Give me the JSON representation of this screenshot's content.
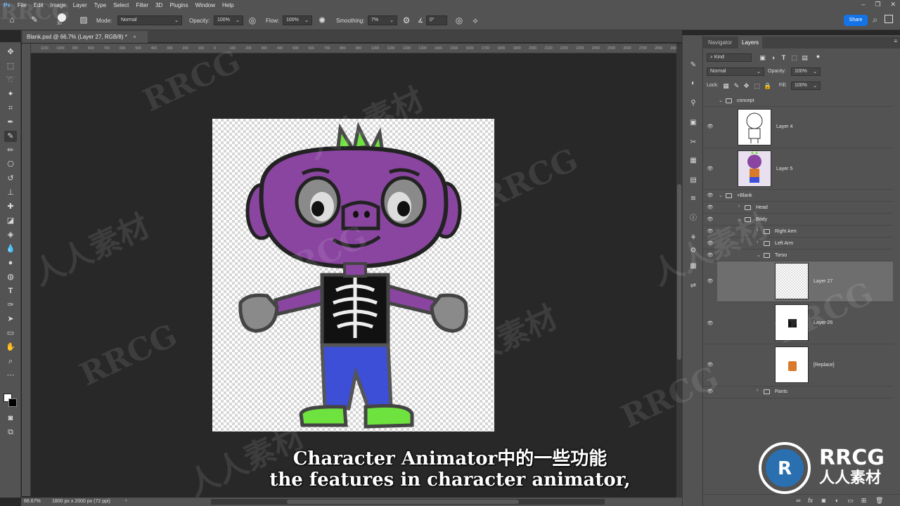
{
  "menubar": {
    "items": [
      "File",
      "Edit",
      "Image",
      "Layer",
      "Type",
      "Select",
      "Filter",
      "3D",
      "Plugins",
      "Window",
      "Help"
    ]
  },
  "options": {
    "brush_size": "30",
    "mode_label": "Mode:",
    "mode_value": "Normal",
    "opacity_label": "Opacity:",
    "opacity_value": "100%",
    "flow_label": "Flow:",
    "flow_value": "100%",
    "smoothing_label": "Smoothing:",
    "smoothing_value": "7%",
    "angle_value": "0°",
    "share_label": "Share"
  },
  "document": {
    "tab_title": "Blank.psd @ 66.7% (Layer 27, RGB/8) *",
    "close_glyph": "×"
  },
  "ruler": {
    "ticks": [
      "1100",
      "1000",
      "900",
      "800",
      "700",
      "600",
      "500",
      "400",
      "300",
      "200",
      "100",
      "0",
      "100",
      "200",
      "300",
      "400",
      "500",
      "600",
      "700",
      "800",
      "900",
      "1000",
      "1100",
      "1200",
      "1300",
      "1400",
      "1500",
      "1600",
      "1700",
      "1800",
      "1900",
      "2000",
      "2100",
      "2200",
      "2300",
      "2400",
      "2500",
      "2600",
      "2700",
      "2800",
      "2900"
    ]
  },
  "status": {
    "zoom": "66.67%",
    "doc_info": "1800 px x 2000 px (72 ppi)"
  },
  "panel": {
    "tabs": [
      "Navigator",
      "Layers"
    ],
    "active_tab": "Layers",
    "kind_label": "Kind",
    "blend_mode": "Normal",
    "opacity_label": "Opacity:",
    "opacity_value": "100%",
    "lock_label": "Lock:",
    "fill_label": "Fill:",
    "fill_value": "100%"
  },
  "layers": {
    "concept": "concept",
    "layer4": "Layer 4",
    "layer5": "Layer 5",
    "blank": "+Blank",
    "head": "Head",
    "body": "Body",
    "right_arm": "Right Arm",
    "left_arm": "Left Arm",
    "torso": "Torso",
    "layer27": "Layer 27",
    "layer26": "Layer 26",
    "replace": "[Replace]",
    "pants": "Pants"
  },
  "subtitles": {
    "line_cn": "Character Animator中的一些功能",
    "line_en": "the features in character animator,"
  },
  "watermark": {
    "rrcg": "RRCG",
    "cn": "人人素材",
    "logo_top": "RRCG",
    "logo_bottom": "人人素材"
  },
  "colors": {
    "accent": "#1473e6",
    "character_purple": "#8a45a0",
    "character_green": "#6ee23e",
    "pants_blue": "#3d4fd6"
  }
}
